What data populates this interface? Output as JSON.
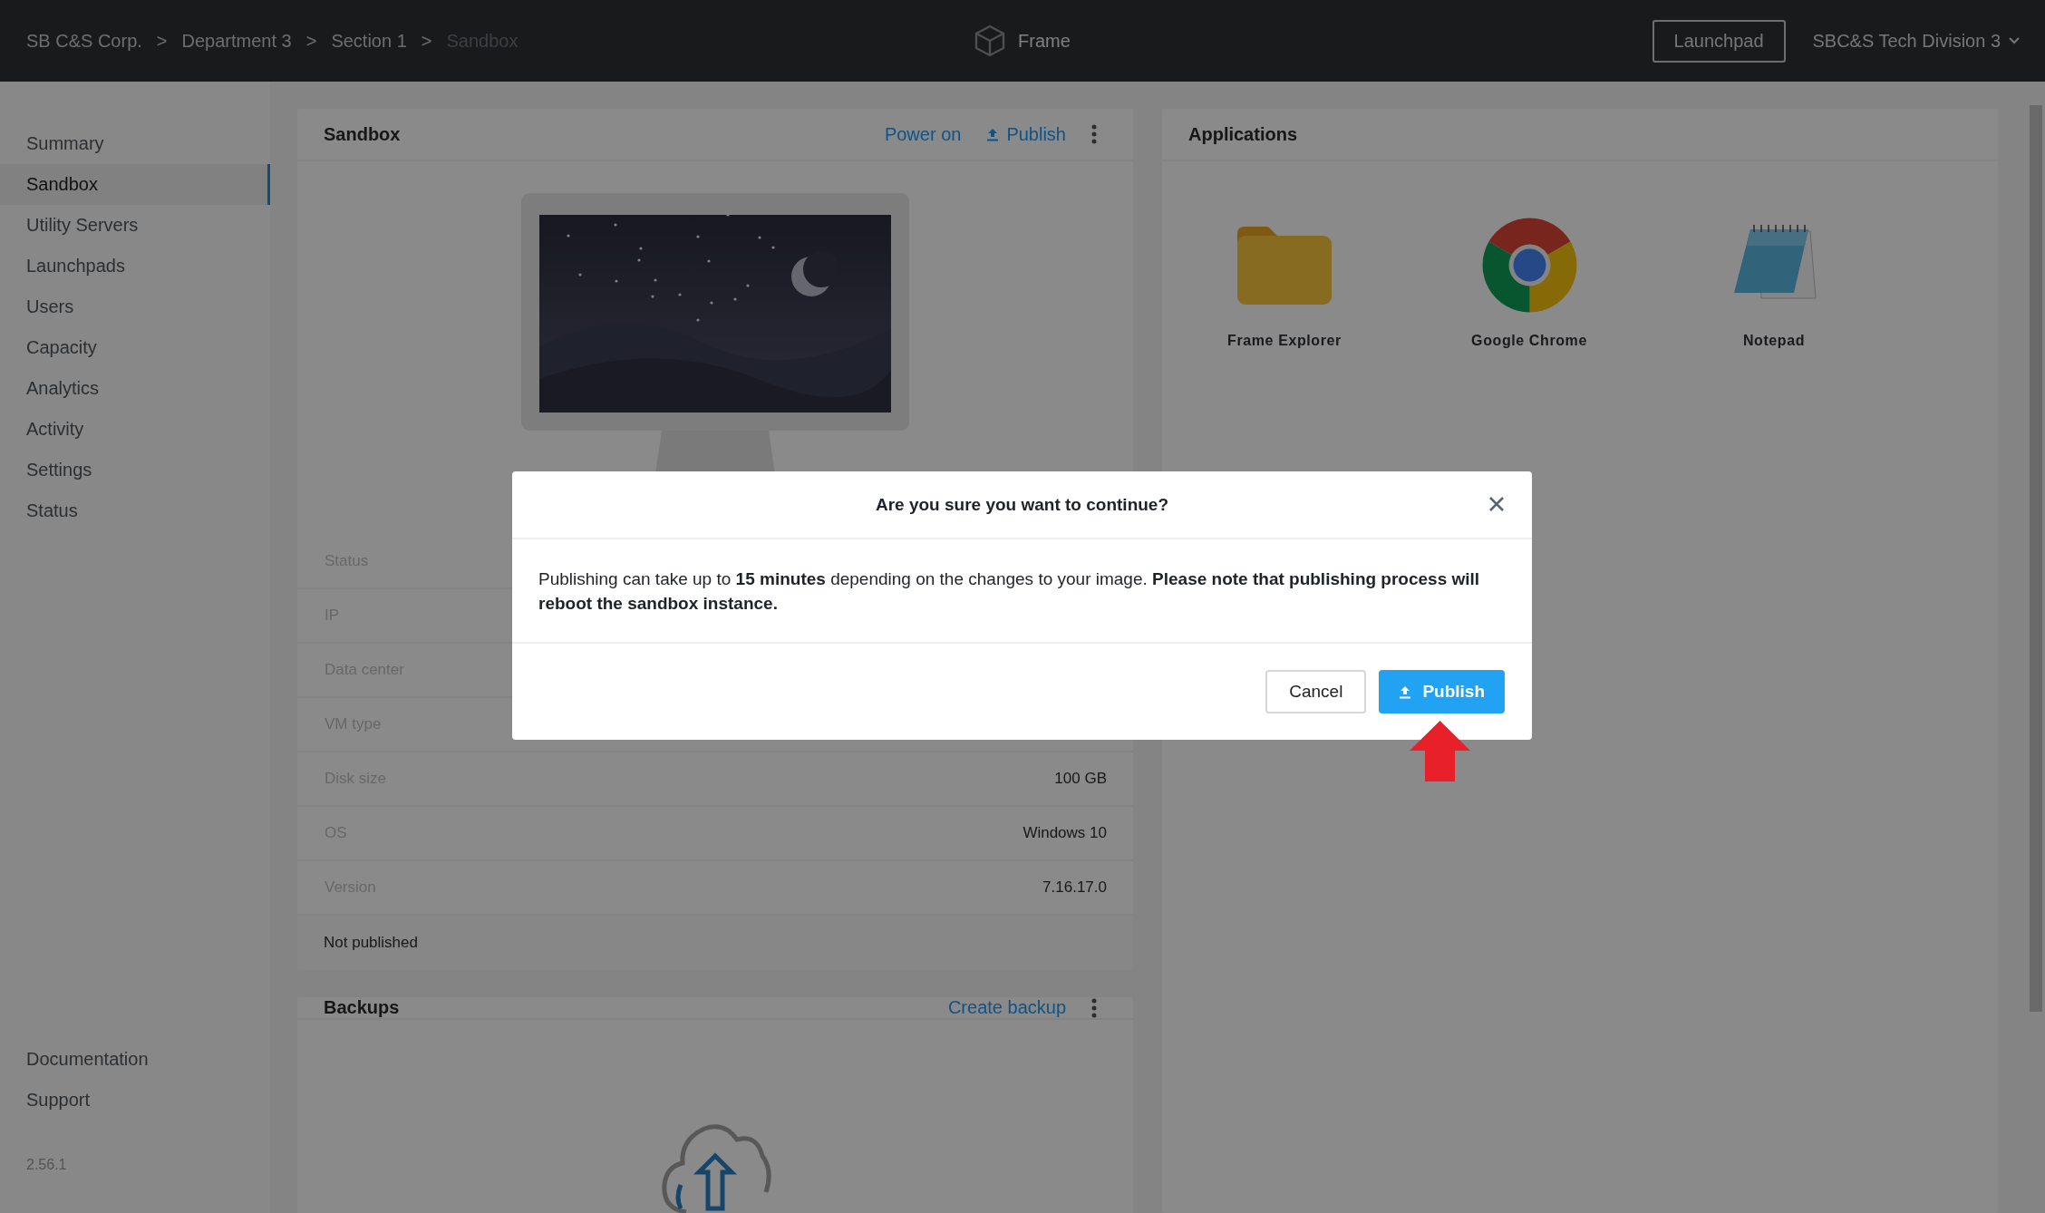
{
  "topbar": {
    "breadcrumbs": [
      {
        "label": "SB C&S Corp.",
        "current": false,
        "separator": ">"
      },
      {
        "label": "Department 3",
        "current": false,
        "separator": ">"
      },
      {
        "label": "Section 1",
        "current": false,
        "separator": ">"
      },
      {
        "label": "Sandbox",
        "current": true
      }
    ],
    "product": "Frame",
    "launchpad_button": "Launchpad",
    "account_menu": "SBC&S Tech Division 3"
  },
  "sidebar": {
    "items": [
      {
        "label": "Summary",
        "selected": false
      },
      {
        "label": "Sandbox",
        "selected": true
      },
      {
        "label": "Utility Servers",
        "selected": false
      },
      {
        "label": "Launchpads",
        "selected": false
      },
      {
        "label": "Users",
        "selected": false
      },
      {
        "label": "Capacity",
        "selected": false
      },
      {
        "label": "Analytics",
        "selected": false
      },
      {
        "label": "Activity",
        "selected": false
      },
      {
        "label": "Settings",
        "selected": false
      },
      {
        "label": "Status",
        "selected": false
      }
    ],
    "footer_links": [
      "Documentation",
      "Support"
    ],
    "version": "2.56.1"
  },
  "sandbox": {
    "title": "Sandbox",
    "actions": [
      {
        "label": "Power on",
        "kind": "link"
      },
      {
        "label": "Publish",
        "kind": "upload"
      }
    ],
    "details": [
      {
        "label": "Status"
      },
      {
        "label": "IP"
      },
      {
        "label": "Data center"
      },
      {
        "label": "VM type"
      },
      {
        "label": "Disk size",
        "value": "100 GB"
      },
      {
        "label": "OS",
        "value": "Windows 10"
      },
      {
        "label": "Version",
        "value": "7.16.17.0"
      }
    ],
    "publish_status": "Not published"
  },
  "applications": {
    "title": "Applications",
    "items": [
      {
        "name": "Frame Explorer",
        "kind": "folder"
      },
      {
        "name": "Google Chrome",
        "kind": "browser"
      },
      {
        "name": "Notepad",
        "kind": "notepad"
      }
    ]
  },
  "backups": {
    "title": "Backups",
    "action": "Create backup"
  },
  "dialog": {
    "title": "Are you sure you want to continue?",
    "message": "Publishing can take up to **15 minutes** depending on the changes to your image. **Please note that publishing process will reboot the sandbox instance.**",
    "buttons": [
      {
        "label": "Cancel",
        "kind": "secondary"
      },
      {
        "label": "Publish",
        "kind": "primary"
      }
    ]
  }
}
